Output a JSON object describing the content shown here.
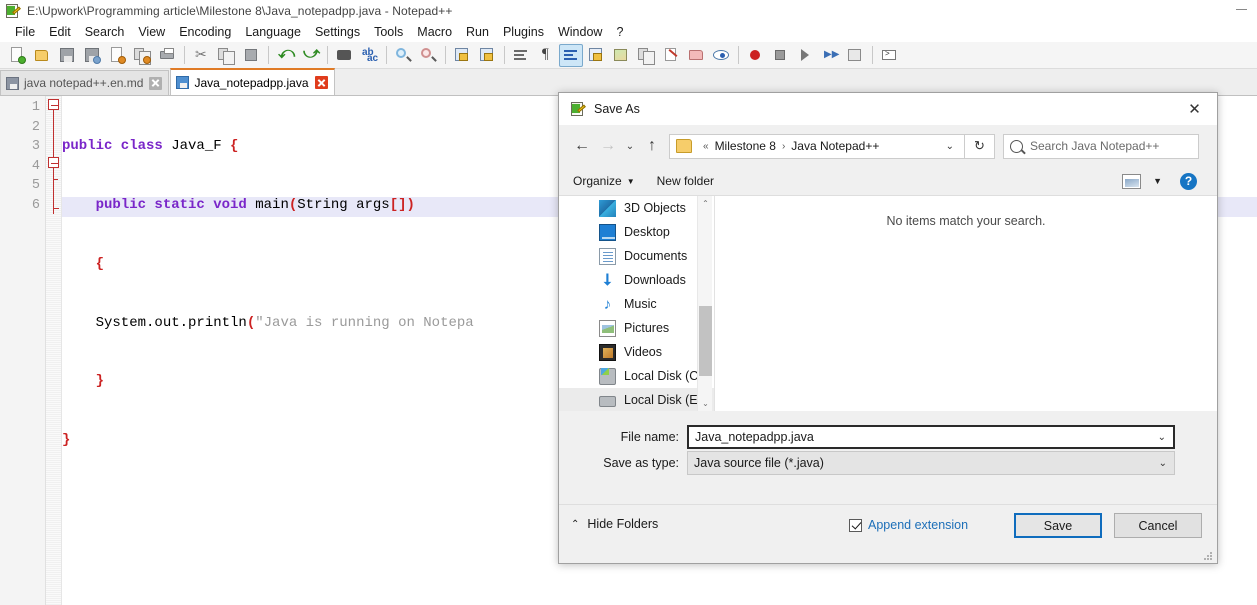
{
  "app": {
    "title": "E:\\Upwork\\Programming article\\Milestone 8\\Java_notepadpp.java - Notepad++",
    "icon": "notepad-plus-plus-icon",
    "minimize_label": "Minimize"
  },
  "menubar": {
    "items": [
      {
        "label": "File"
      },
      {
        "label": "Edit"
      },
      {
        "label": "Search"
      },
      {
        "label": "View"
      },
      {
        "label": "Encoding"
      },
      {
        "label": "Language"
      },
      {
        "label": "Settings"
      },
      {
        "label": "Tools"
      },
      {
        "label": "Macro"
      },
      {
        "label": "Run"
      },
      {
        "label": "Plugins"
      },
      {
        "label": "Window"
      },
      {
        "label": "?"
      }
    ]
  },
  "toolbar": {
    "buttons": [
      {
        "name": "new-file-icon"
      },
      {
        "name": "open-file-icon"
      },
      {
        "name": "save-icon"
      },
      {
        "name": "save-all-icon"
      },
      {
        "name": "close-file-icon"
      },
      {
        "name": "close-all-icon"
      },
      {
        "name": "print-icon"
      },
      {
        "name": "cut-icon"
      },
      {
        "name": "copy-icon"
      },
      {
        "name": "paste-icon"
      },
      {
        "name": "undo-icon"
      },
      {
        "name": "redo-icon"
      },
      {
        "name": "find-icon"
      },
      {
        "name": "replace-icon"
      },
      {
        "name": "zoom-in-icon"
      },
      {
        "name": "zoom-out-icon"
      },
      {
        "name": "sync-vertical-icon"
      },
      {
        "name": "sync-horizontal-icon"
      },
      {
        "name": "word-wrap-icon"
      },
      {
        "name": "show-all-characters-icon"
      },
      {
        "name": "indent-guideline-icon"
      },
      {
        "name": "user-defined-dialog-icon"
      },
      {
        "name": "document-map-icon"
      },
      {
        "name": "function-list-icon"
      },
      {
        "name": "edit-document-icon"
      },
      {
        "name": "folder-as-workspace-icon"
      },
      {
        "name": "monitoring-icon"
      },
      {
        "name": "macro-record-icon"
      },
      {
        "name": "macro-stop-icon"
      },
      {
        "name": "macro-play-icon"
      },
      {
        "name": "macro-playback-multiple-icon"
      },
      {
        "name": "macro-save-icon"
      },
      {
        "name": "run-console-icon"
      }
    ]
  },
  "tabs": [
    {
      "label": "java notepad++.en.md",
      "active": false
    },
    {
      "label": "Java_notepadpp.java",
      "active": true
    }
  ],
  "editor": {
    "line_numbers": [
      "1",
      "2",
      "3",
      "4",
      "5",
      "6"
    ],
    "lines": [
      {
        "segments": [
          {
            "text": "public class ",
            "type": "kw"
          },
          {
            "text": "Java_F ",
            "type": "plain"
          },
          {
            "text": "{",
            "type": "brc"
          }
        ]
      },
      {
        "segments": [
          {
            "text": "    ",
            "type": "plain"
          },
          {
            "text": "public static void ",
            "type": "kw"
          },
          {
            "text": "main",
            "type": "plain"
          },
          {
            "text": "(",
            "type": "brc"
          },
          {
            "text": "String args",
            "type": "plain"
          },
          {
            "text": "[])",
            "type": "brc"
          }
        ]
      },
      {
        "segments": [
          {
            "text": "    ",
            "type": "plain"
          },
          {
            "text": "{",
            "type": "brc"
          }
        ]
      },
      {
        "segments": [
          {
            "text": "    System.out.println",
            "type": "plain"
          },
          {
            "text": "(",
            "type": "brc"
          },
          {
            "text": "\"Java is running on Notepa",
            "type": "str"
          }
        ]
      },
      {
        "segments": [
          {
            "text": "    ",
            "type": "plain"
          },
          {
            "text": "}",
            "type": "brc"
          }
        ]
      },
      {
        "segments": [
          {
            "text": "}",
            "type": "brc"
          }
        ]
      }
    ],
    "current_line": 6
  },
  "dialog": {
    "title": "Save As",
    "icon": "notepad-plus-plus-icon",
    "close_label": "✕",
    "nav": {
      "back_label": "←",
      "forward_label": "→",
      "recent_label": "⌄",
      "up_label": "↑",
      "breadcrumb_prefix": "«",
      "breadcrumb": [
        "Milestone 8",
        "Java Notepad++"
      ],
      "breadcrumb_separator": "›",
      "dropdown_caret": "⌄",
      "refresh_label": "↻"
    },
    "search": {
      "placeholder": "Search Java Notepad++",
      "value": ""
    },
    "commandbar": {
      "organize_label": "Organize",
      "organize_caret": "▼",
      "new_folder_label": "New folder",
      "view_caret": "▼",
      "help_label": "?"
    },
    "navpane": {
      "items": [
        {
          "label": "3D Objects",
          "icon": "3d-objects-icon",
          "selected": false
        },
        {
          "label": "Desktop",
          "icon": "desktop-icon",
          "selected": false
        },
        {
          "label": "Documents",
          "icon": "documents-icon",
          "selected": false
        },
        {
          "label": "Downloads",
          "icon": "downloads-icon",
          "selected": false
        },
        {
          "label": "Music",
          "icon": "music-icon",
          "selected": false
        },
        {
          "label": "Pictures",
          "icon": "pictures-icon",
          "selected": false
        },
        {
          "label": "Videos",
          "icon": "videos-icon",
          "selected": false
        },
        {
          "label": "Local Disk (C:)",
          "icon": "local-disk-c-icon",
          "selected": false
        },
        {
          "label": "Local Disk (E:)",
          "icon": "local-disk-e-icon",
          "selected": true
        }
      ],
      "scroll_up": "⌃",
      "scroll_down": "⌄"
    },
    "filelist": {
      "empty_message": "No items match your search."
    },
    "form": {
      "filename_label": "File name:",
      "filename_value": "Java_notepadpp.java",
      "filetype_label": "Save as type:",
      "filetype_value": "Java source file (*.java)",
      "dropdown_caret": "⌄"
    },
    "footer": {
      "hide_folders_label": "Hide Folders",
      "hide_folders_caret": "⌃",
      "append_extension_label": "Append extension",
      "append_extension_checked": true,
      "save_label": "Save",
      "cancel_label": "Cancel"
    }
  },
  "colors": {
    "accent_blue": "#0f6cbd",
    "tab_active_orange": "#e07b26",
    "keyword_purple": "#7a26c9",
    "brace_red": "#cc2222",
    "string_gray": "#9a9a9a",
    "link_blue": "#1d6fb8",
    "fold_red": "#c03030",
    "current_line": "#e8e8f8"
  }
}
